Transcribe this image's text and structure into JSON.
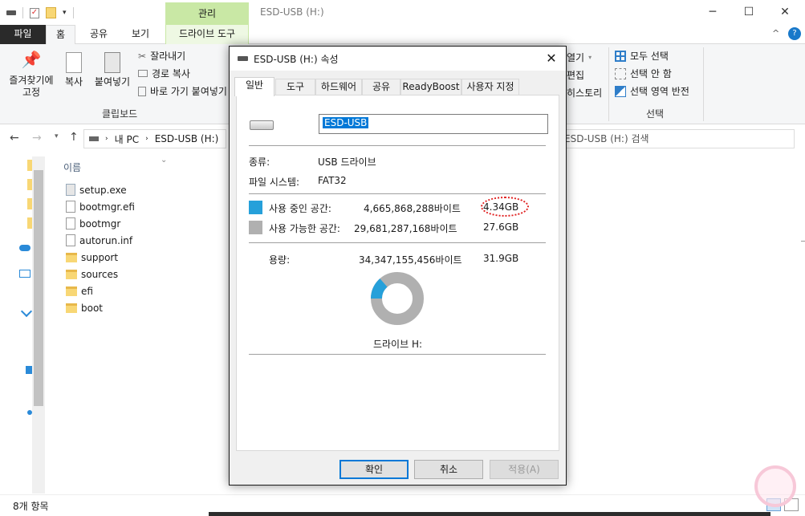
{
  "window": {
    "title": "ESD-USB (H:)",
    "context_tab": "관리",
    "minimize": "─",
    "maximize": "☐",
    "close": "✕"
  },
  "ribbon_tabs": {
    "file": "파일",
    "home": "홈",
    "share": "공유",
    "view": "보기",
    "drive_tools": "드라이브 도구"
  },
  "ribbon": {
    "pin_line1": "즐겨찾기에",
    "pin_line2": "고정",
    "copy": "복사",
    "paste": "붙여넣기",
    "cut": "잘라내기",
    "copy_path": "경로 복사",
    "paste_shortcut": "바로 가기 붙여넣기",
    "clipboard_group": "클립보드",
    "open_partial": "열기",
    "edit_partial": "편집",
    "history_partial": "히스토리",
    "select_all": "모두 선택",
    "select_none": "선택 안 함",
    "invert_selection": "선택 영역 반전",
    "select_group": "선택"
  },
  "address": {
    "path_pc": "내 PC",
    "path_drive": "ESD-USB (H:)",
    "search_placeholder": "ESD-USB (H:) 검색"
  },
  "file_list": {
    "column_name": "이름",
    "items": [
      "setup.exe",
      "bootmgr.efi",
      "bootmgr",
      "autorun.inf",
      "support",
      "sources",
      "efi",
      "boot"
    ]
  },
  "status": {
    "item_count": "8개 항목"
  },
  "dialog": {
    "title": "ESD-USB (H:) 속성",
    "close": "✕",
    "tabs": [
      "일반",
      "도구",
      "하드웨어",
      "공유",
      "ReadyBoost",
      "사용자 지정"
    ],
    "drive_name": "ESD-USB",
    "type_label": "종류:",
    "type_value": "USB 드라이브",
    "fs_label": "파일 시스템:",
    "fs_value": "FAT32",
    "used_label": "사용 중인 공간:",
    "used_bytes": "4,665,868,288바이트",
    "used_size": "4.34GB",
    "free_label": "사용 가능한 공간:",
    "free_bytes": "29,681,287,168바이트",
    "free_size": "27.6GB",
    "capacity_label": "용량:",
    "capacity_bytes": "34,347,155,456바이트",
    "capacity_size": "31.9GB",
    "drive_label": "드라이브 H:",
    "used_fraction": 0.136,
    "used_color": "#26a0da",
    "free_color": "#b0b0b0",
    "ok": "확인",
    "cancel": "취소",
    "apply": "적용(A)"
  }
}
